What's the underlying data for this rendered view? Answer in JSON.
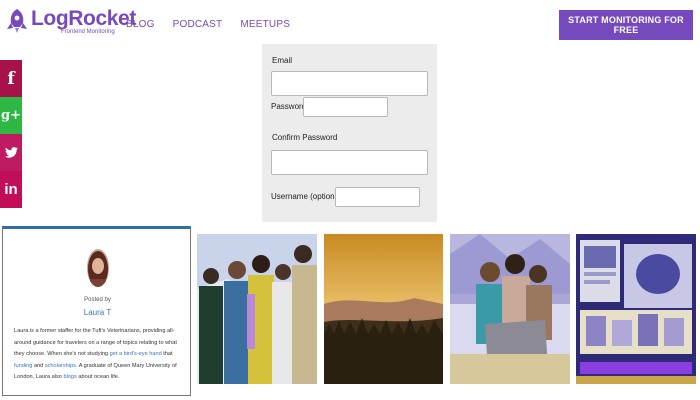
{
  "header": {
    "logo_name": "LogRocket",
    "logo_sub": "Frontend Monitoring",
    "nav": [
      "BLOG",
      "PODCAST",
      "MEETUPS"
    ],
    "cta_label": "START MONITORING FOR FREE"
  },
  "social": [
    {
      "icon": "facebook-icon",
      "glyph": "f"
    },
    {
      "icon": "google-plus-icon",
      "glyph": "g+"
    },
    {
      "icon": "twitter-icon",
      "glyph": ""
    },
    {
      "icon": "linkedin-icon",
      "glyph": "in"
    }
  ],
  "form": {
    "email_label": "Email",
    "password_label": "Password",
    "confirm_label": "Confirm Password",
    "username_label": "Username (optional)"
  },
  "card": {
    "byline": "Posted by",
    "author": "Laura T",
    "bio_1": "Laura is a former staffer for the Tuft's Veterinarians, providing all-around guidance for",
    "bio_2": "travelers on a range of topics relating to what they choose. When she's not studying ",
    "bio_link_1": "get a bird's-eye hand",
    "bio_3": "that ",
    "bio_link_2": "funding",
    "bio_4": " and ",
    "bio_link_3": "scholarships",
    "bio_5": ". A graduate of Queen Mary University of London, Laura also",
    "bio_link_4": "blogs",
    "bio_6": " about ocean life."
  },
  "colors": {
    "brand": "#764abc",
    "facebook": "#a8124a",
    "google_plus": "#2eb843",
    "twitter": "#be1b63",
    "linkedin": "#c10e5a",
    "card_accent": "#2d6ea8"
  }
}
